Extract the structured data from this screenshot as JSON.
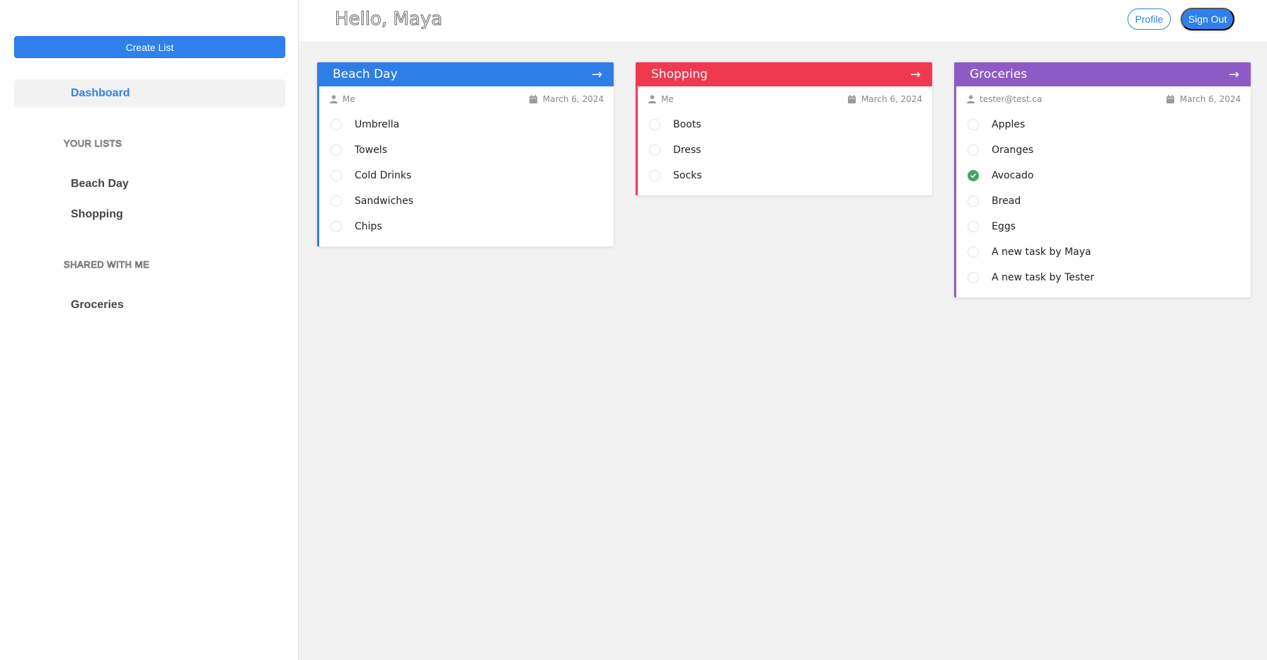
{
  "sidebar": {
    "create_label": "Create List",
    "dashboard_label": "Dashboard",
    "your_lists_heading": "YOUR LISTS",
    "your_lists": [
      "Beach Day",
      "Shopping"
    ],
    "shared_heading": "SHARED WITH ME",
    "shared_lists": [
      "Groceries"
    ]
  },
  "header": {
    "greeting": "Hello, Maya",
    "profile_label": "Profile",
    "signout_label": "Sign Out"
  },
  "colors": {
    "accent": "#2f80ed",
    "beach": "#2f7de6",
    "shopping": "#f0394f",
    "groceries": "#8e5bc6",
    "done": "#43a565"
  },
  "icons": {
    "arrow": "arrow-right-icon",
    "owner": "user-icon",
    "date": "calendar-icon",
    "checked": "check-circle-icon"
  },
  "cards": [
    {
      "title": "Beach Day",
      "owner": "Me",
      "date": "March 6, 2024",
      "tasks": [
        {
          "label": "Umbrella",
          "done": false
        },
        {
          "label": "Towels",
          "done": false
        },
        {
          "label": "Cold Drinks",
          "done": false
        },
        {
          "label": "Sandwiches",
          "done": false
        },
        {
          "label": "Chips",
          "done": false
        }
      ]
    },
    {
      "title": "Shopping",
      "owner": "Me",
      "date": "March 6, 2024",
      "tasks": [
        {
          "label": "Boots",
          "done": false
        },
        {
          "label": "Dress",
          "done": false
        },
        {
          "label": "Socks",
          "done": false
        }
      ]
    },
    {
      "title": "Groceries",
      "owner": "tester@test.ca",
      "date": "March 6, 2024",
      "tasks": [
        {
          "label": "Apples",
          "done": false
        },
        {
          "label": "Oranges",
          "done": false
        },
        {
          "label": "Avocado",
          "done": true
        },
        {
          "label": "Bread",
          "done": false
        },
        {
          "label": "Eggs",
          "done": false
        },
        {
          "label": "A new task by Maya",
          "done": false
        },
        {
          "label": "A new task by Tester",
          "done": false
        }
      ]
    }
  ]
}
